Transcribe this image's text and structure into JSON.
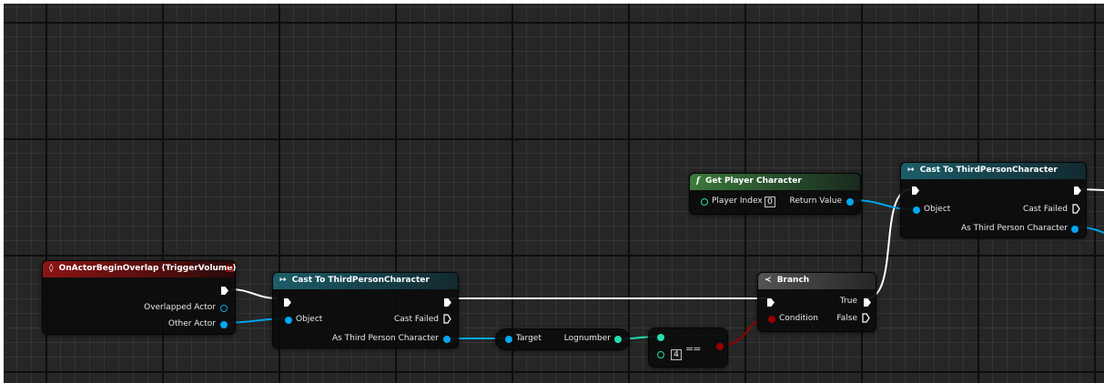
{
  "editor": {
    "name": "Unreal Engine Blueprint Event Graph"
  },
  "nodes": {
    "event_overlap": {
      "title": "OnActorBeginOverlap (TriggerVolume)",
      "icon": "event-diamond-icon",
      "pins": {
        "overlapped_actor": "Overlapped Actor",
        "other_actor": "Other Actor"
      }
    },
    "cast_1": {
      "title": "Cast To ThirdPersonCharacter",
      "icon": "cast-arrows-icon",
      "pins": {
        "object": "Object",
        "cast_failed": "Cast Failed",
        "as_third_person": "As Third Person Character"
      }
    },
    "logn": {
      "pins": {
        "target": "Target",
        "lognumber": "Lognumber"
      }
    },
    "equal": {
      "value": "4",
      "symbol": "=="
    },
    "branch": {
      "title": "Branch",
      "icon": "branch-icon",
      "pins": {
        "true": "True",
        "condition": "Condition",
        "false": "False"
      }
    },
    "get_player": {
      "title": "Get Player Character",
      "icon": "function-f-icon",
      "pins": {
        "player_index": "Player Index",
        "player_index_value": "0",
        "return_value": "Return Value"
      }
    },
    "cast_2": {
      "title": "Cast To ThirdPersonCharacter",
      "icon": "cast-arrows-icon",
      "pins": {
        "object": "Object",
        "cast_failed": "Cast Failed",
        "as_third_person": "As Third Person Character"
      }
    }
  },
  "colors": {
    "background": "#262626",
    "exec_wire": "#ffffff",
    "object_wire": "#00a8f0",
    "int_wire": "#1fe0b0",
    "bool_wire": "#960000",
    "event_header": "#8c1414",
    "cast_header": "#1c5e6a",
    "function_header": "#3c7a3a",
    "branch_header": "#545454"
  }
}
